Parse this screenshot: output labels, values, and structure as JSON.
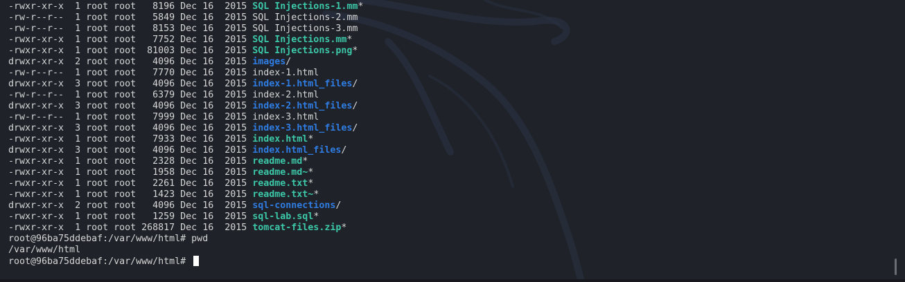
{
  "terminal": {
    "background": "#1f2229",
    "colors": {
      "plain": "#d6d6d6",
      "executable": "#3cc8a8",
      "directory": "#2f7de3"
    },
    "rows": [
      {
        "meta": "-rwxr-xr-x  1 root root   8196 Dec 16  2015 ",
        "name": "SQL Injections-1.mm",
        "kind": "exec",
        "suffix": "*"
      },
      {
        "meta": "-rw-r--r--  1 root root   5849 Dec 16  2015 ",
        "name": "SQL Injections-2.mm",
        "kind": "plain",
        "suffix": ""
      },
      {
        "meta": "-rw-r--r--  1 root root   8153 Dec 16  2015 ",
        "name": "SQL Injections-3.mm",
        "kind": "plain",
        "suffix": ""
      },
      {
        "meta": "-rwxr-xr-x  1 root root   7752 Dec 16  2015 ",
        "name": "SQL Injections.mm",
        "kind": "exec",
        "suffix": "*"
      },
      {
        "meta": "-rwxr-xr-x  1 root root  81003 Dec 16  2015 ",
        "name": "SQL Injections.png",
        "kind": "exec",
        "suffix": "*"
      },
      {
        "meta": "drwxr-xr-x  2 root root   4096 Dec 16  2015 ",
        "name": "images",
        "kind": "dir",
        "suffix": "/"
      },
      {
        "meta": "-rw-r--r--  1 root root   7770 Dec 16  2015 ",
        "name": "index-1.html",
        "kind": "plain",
        "suffix": ""
      },
      {
        "meta": "drwxr-xr-x  3 root root   4096 Dec 16  2015 ",
        "name": "index-1.html_files",
        "kind": "dir",
        "suffix": "/"
      },
      {
        "meta": "-rw-r--r--  1 root root   6379 Dec 16  2015 ",
        "name": "index-2.html",
        "kind": "plain",
        "suffix": ""
      },
      {
        "meta": "drwxr-xr-x  3 root root   4096 Dec 16  2015 ",
        "name": "index-2.html_files",
        "kind": "dir",
        "suffix": "/"
      },
      {
        "meta": "-rw-r--r--  1 root root   7999 Dec 16  2015 ",
        "name": "index-3.html",
        "kind": "plain",
        "suffix": ""
      },
      {
        "meta": "drwxr-xr-x  3 root root   4096 Dec 16  2015 ",
        "name": "index-3.html_files",
        "kind": "dir",
        "suffix": "/"
      },
      {
        "meta": "-rwxr-xr-x  1 root root   7933 Dec 16  2015 ",
        "name": "index.html",
        "kind": "exec",
        "suffix": "*"
      },
      {
        "meta": "drwxr-xr-x  3 root root   4096 Dec 16  2015 ",
        "name": "index.html_files",
        "kind": "dir",
        "suffix": "/"
      },
      {
        "meta": "-rwxr-xr-x  1 root root   2328 Dec 16  2015 ",
        "name": "readme.md",
        "kind": "exec",
        "suffix": "*"
      },
      {
        "meta": "-rwxr-xr-x  1 root root   1958 Dec 16  2015 ",
        "name": "readme.md~",
        "kind": "exec",
        "suffix": "*"
      },
      {
        "meta": "-rwxr-xr-x  1 root root   2261 Dec 16  2015 ",
        "name": "readme.txt",
        "kind": "exec",
        "suffix": "*"
      },
      {
        "meta": "-rwxr-xr-x  1 root root   1423 Dec 16  2015 ",
        "name": "readme.txt~",
        "kind": "exec",
        "suffix": "*"
      },
      {
        "meta": "drwxr-xr-x  2 root root   4096 Dec 16  2015 ",
        "name": "sql-connections",
        "kind": "dir",
        "suffix": "/"
      },
      {
        "meta": "-rwxr-xr-x  1 root root   1259 Dec 16  2015 ",
        "name": "sql-lab.sql",
        "kind": "exec",
        "suffix": "*"
      },
      {
        "meta": "-rwxr-xr-x  1 root root 268817 Dec 16  2015 ",
        "name": "tomcat-files.zip",
        "kind": "exec",
        "suffix": "*"
      }
    ],
    "command_line": "root@96ba75ddebaf:/var/www/html# pwd",
    "output_line": "/var/www/html",
    "prompt": "root@96ba75ddebaf:/var/www/html# "
  }
}
